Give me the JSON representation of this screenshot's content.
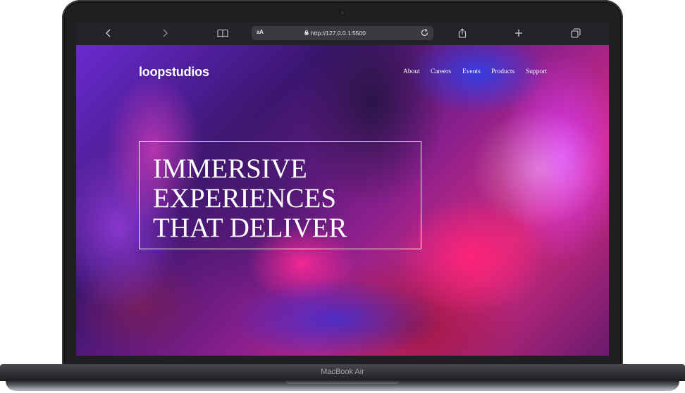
{
  "device": {
    "label": "MacBook Air"
  },
  "browser": {
    "back_icon": "chevron-left-icon",
    "forward_icon": "chevron-right-icon",
    "reader_icon": "book-icon",
    "text_size_label": "aA",
    "url": "http://127.0.0.1:5500",
    "lock_icon": "lock-icon",
    "reload_icon": "reload-icon",
    "share_icon": "share-icon",
    "new_tab_icon": "plus-icon",
    "tabs_icon": "tabs-icon"
  },
  "site": {
    "logo": "loopstudios",
    "nav": [
      "About",
      "Careers",
      "Events",
      "Products",
      "Support"
    ],
    "hero": {
      "lines": [
        "IMMERSIVE",
        "EXPERIENCES",
        "THAT DELIVER"
      ]
    },
    "colors": {
      "text": "#ffffff",
      "toolbar": "#232427"
    }
  }
}
